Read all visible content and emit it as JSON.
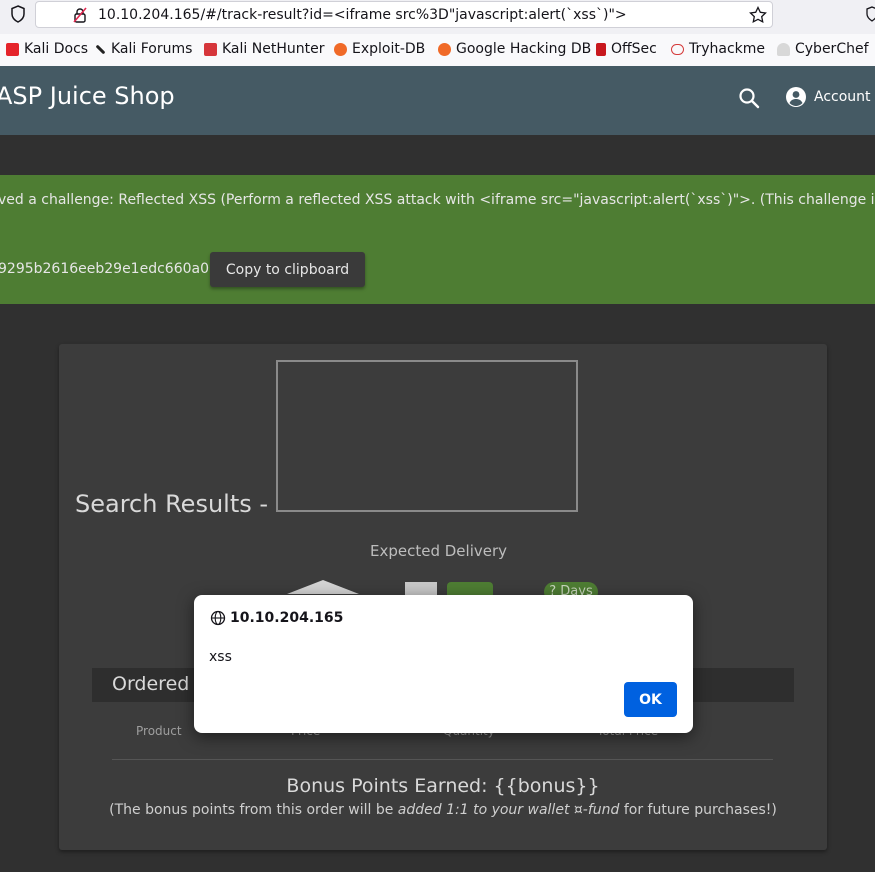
{
  "browser": {
    "url_host": "10.10.204.165",
    "url_path": "/#/track-result?id=<iframe src%3D\"javascript:alert(`xss`)\">"
  },
  "bookmarks": [
    {
      "label": "Kali Docs",
      "icon": "kali-docs-icon",
      "color": "#e5242b"
    },
    {
      "label": "Kali Forums",
      "icon": "kali-forums-icon",
      "color": "#222222"
    },
    {
      "label": "Kali NetHunter",
      "icon": "nethunter-icon",
      "color": "#d6363b"
    },
    {
      "label": "Exploit-DB",
      "icon": "exploit-db-icon",
      "color": "#f06a28"
    },
    {
      "label": "Google Hacking DB",
      "icon": "ghdb-icon",
      "color": "#f06a28"
    },
    {
      "label": "OffSec",
      "icon": "offsec-icon",
      "color": "#c8181e"
    },
    {
      "label": "Tryhackme",
      "icon": "tryhackme-icon",
      "color": "#d53b3b"
    },
    {
      "label": "CyberChef",
      "icon": "cyberchef-icon",
      "color": "#9a9a9a"
    }
  ],
  "app": {
    "title": "ASP Juice Shop",
    "account_label": "Account"
  },
  "banner": {
    "message": "ved a challenge: Reflected XSS (Perform a reflected XSS attack with <iframe src=\"javascript:alert(`xss`)\">. (This challenge is",
    "flag": "9295b2616eeb29e1edc660a0",
    "copy_label": "Copy to clipboard"
  },
  "card": {
    "search_title": "Search Results -",
    "expected_delivery": "Expected Delivery",
    "days_badge": "? Days",
    "ordered_title": "Ordered",
    "columns": [
      "Product",
      "Price",
      "Quantity",
      "Total Price"
    ],
    "bonus_title": "Bonus Points Earned: {{bonus}}",
    "bonus_note_prefix": "(The bonus points from this order will be ",
    "bonus_note_em": "added 1:1 to your wallet ¤-fund",
    "bonus_note_suffix": " for future purchases!)"
  },
  "dialog": {
    "origin": "10.10.204.165",
    "message": "xss",
    "ok_label": "OK"
  },
  "colors": {
    "toolbar": "#455a64",
    "banner": "#4e7d33",
    "ok_button": "#0061e0"
  }
}
